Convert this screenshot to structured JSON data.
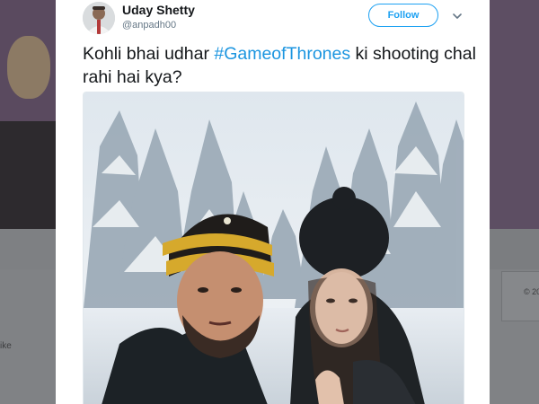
{
  "tweet": {
    "author": {
      "display_name": "Uday Shetty",
      "handle": "@anpadh00"
    },
    "follow_label": "Follow",
    "text": {
      "before": "Kohli bhai udhar ",
      "hashtag": "#GameofThrones",
      "after": " ki shooting chal rahi hai kya?"
    },
    "photo_alt": "Snowy forest selfie of a couple in winter hats"
  },
  "background_page": {
    "left_fragment": "ike",
    "right_fragment": "© 20"
  },
  "colors": {
    "accent": "#1da1f2",
    "hashtag": "#1b95e0",
    "name_text": "#14171a",
    "secondary_text": "#657786",
    "overlay": "#7b7d80"
  },
  "icons": {
    "menu_caret": "chevron-down-icon"
  }
}
